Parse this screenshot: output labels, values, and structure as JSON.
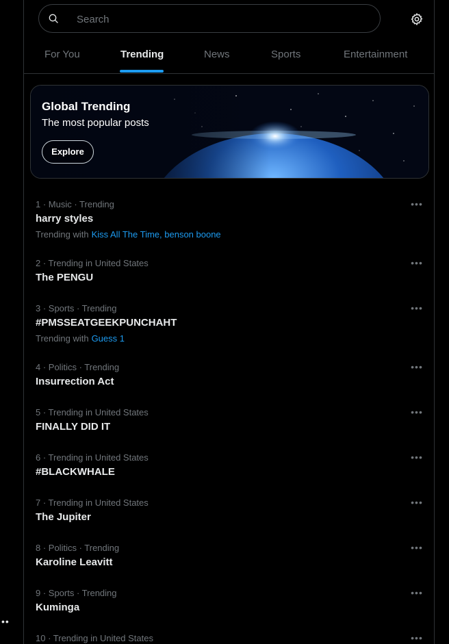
{
  "search": {
    "placeholder": "Search"
  },
  "tabs": [
    {
      "label": "For You"
    },
    {
      "label": "Trending"
    },
    {
      "label": "News"
    },
    {
      "label": "Sports"
    },
    {
      "label": "Entertainment"
    }
  ],
  "active_tab": "Trending",
  "banner": {
    "title": "Global Trending",
    "subtitle": "The most popular posts",
    "button": "Explore"
  },
  "trends": [
    {
      "meta": "1 · Music · Trending",
      "name": "harry styles",
      "with_label": "Trending with",
      "with_links": "Kiss All The Time, benson boone"
    },
    {
      "meta": "2 · Trending in United States",
      "name": "The PENGU"
    },
    {
      "meta": "3 · Sports · Trending",
      "name": "#PMSSEATGEEKPUNCHAHT",
      "with_label": "Trending with",
      "with_links": "Guess 1"
    },
    {
      "meta": "4 · Politics · Trending",
      "name": "Insurrection Act"
    },
    {
      "meta": "5 · Trending in United States",
      "name": "FINALLY DID IT"
    },
    {
      "meta": "6 · Trending in United States",
      "name": "#BLACKWHALE"
    },
    {
      "meta": "7 · Trending in United States",
      "name": "The Jupiter"
    },
    {
      "meta": "8 · Politics · Trending",
      "name": "Karoline Leavitt"
    },
    {
      "meta": "9 · Sports · Trending",
      "name": "Kuminga"
    },
    {
      "meta": "10 · Trending in United States",
      "name": ""
    }
  ],
  "more_glyph": "•••",
  "colors": {
    "accent": "#1d9bf0",
    "background": "#000000",
    "muted": "#71767b",
    "text": "#e7e9ea",
    "border": "#2f3336"
  }
}
